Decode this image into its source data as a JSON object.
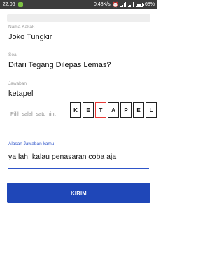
{
  "status_bar": {
    "time": "22:06",
    "network_speed": "0.48K/s",
    "battery": "68%"
  },
  "form": {
    "nama": {
      "label": "Nama Kakak",
      "value": "Joko Tungkir"
    },
    "soal": {
      "label": "Soal",
      "value": "Ditari Tegang Dilepas Lemas?"
    },
    "jawaban": {
      "label": "Jawaban",
      "value": "ketapel"
    },
    "hint": {
      "label": "Pilih salah satu hint",
      "letters": [
        "K",
        "E",
        "T",
        "A",
        "P",
        "E",
        "L"
      ],
      "selected_index": 2
    },
    "alasan": {
      "label": "Alasan Jawaban kamu",
      "value": "ya lah, kalau penasaran coba aja"
    },
    "submit_label": "KIRIM"
  },
  "colors": {
    "accent": "#1f47b8",
    "focus": "#2f55c9",
    "selected_tile_border": "#e53935",
    "status_bar": "#3c3c3c"
  }
}
